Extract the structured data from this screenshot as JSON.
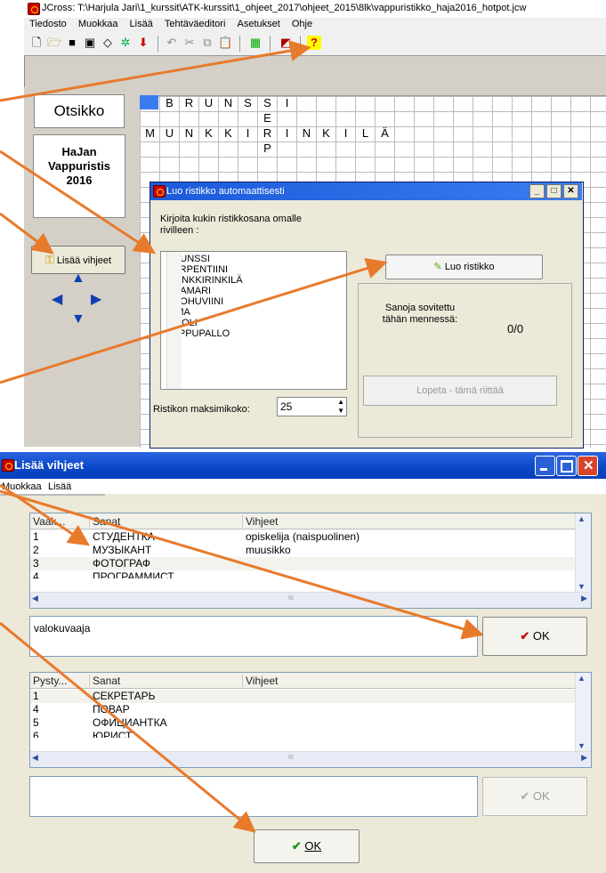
{
  "jcross": {
    "title": "JCross: T:\\Harjula Jari\\1_kurssit\\ATK-kurssit\\1_ohjeet_2017\\ohjeet_2015\\8lk\\vappuristikko_haja2016_hotpot.jcw",
    "menu": [
      "Tiedosto",
      "Muokkaa",
      "Lisää",
      "Tehtäväeditori",
      "Asetukset",
      "Ohje"
    ],
    "otsikko_label": "Otsikko",
    "title_lines": [
      "HaJan",
      "Vappuristis",
      "2016"
    ],
    "lisaa_vihjeet_button": "Lisää vihjeet",
    "grid_rows": [
      {
        "row": 0,
        "start": 1,
        "letters": [
          "B",
          "R",
          "U",
          "N",
          "S",
          "S",
          "I"
        ]
      },
      {
        "row": 1,
        "start": 6,
        "letters": [
          "E"
        ]
      },
      {
        "row": 2,
        "start": 0,
        "letters": [
          "M",
          "U",
          "N",
          "K",
          "K",
          "I",
          "R",
          "I",
          "N",
          "K",
          "I",
          "L",
          "Ä"
        ]
      },
      {
        "row": 3,
        "start": 6,
        "letters": [
          "P"
        ]
      }
    ]
  },
  "luo": {
    "title": "Luo ristikko automaattisesti",
    "instruction_line1": "Kirjoita kukin ristikkosana omalle",
    "instruction_line2": "rivilleen :",
    "words": [
      "BRUNSSI",
      "SERPENTIINI",
      "MUNKKIRINKILÄ",
      "NAAMARI",
      "KUOHUVIINI",
      "SIMA",
      "TIVOLI",
      "VAPPUPALLO"
    ],
    "luo_button": "Luo ristikko",
    "fitted_label_line1": "Sanoja sovitettu",
    "fitted_label_line2": "tähän mennessä:",
    "fitted_value": "0/0",
    "lopeta_button": "Lopeta - tämä riittää",
    "max_label": "Ristikon maksimikoko:",
    "max_value": "25"
  },
  "lisaa": {
    "title": "Lisää vihjeet",
    "menu": [
      "Muokkaa",
      "Lisää"
    ],
    "across": {
      "headers": [
        "Vaak...",
        "Sanat",
        "Vihjeet"
      ],
      "rows": [
        {
          "n": "1",
          "word": "СТУДЕНТКА",
          "clue": "opiskelija (naispuolinen)"
        },
        {
          "n": "2",
          "word": "МУЗЫКАНТ",
          "clue": "muusikko"
        },
        {
          "n": "3",
          "word": "ФОТОГРАФ",
          "clue": ""
        },
        {
          "n": "4",
          "word": "ПРОГРАММИСТ",
          "clue": ""
        }
      ]
    },
    "across_memo": "valokuvaaja",
    "ok_label": "OK",
    "down": {
      "headers": [
        "Pysty...",
        "Sanat",
        "Vihjeet"
      ],
      "rows": [
        {
          "n": "1",
          "word": "СЕКРЕТАРЬ",
          "clue": ""
        },
        {
          "n": "4",
          "word": "ПОВАР",
          "clue": ""
        },
        {
          "n": "5",
          "word": "ОФИЦИАНТКА",
          "clue": ""
        },
        {
          "n": "6",
          "word": "ЮРИСТ",
          "clue": ""
        }
      ]
    },
    "down_memo": "",
    "final_ok_label": "OK",
    "scroll_grip": "III"
  },
  "colors": {
    "arrow": "#e87a2c",
    "titlebar": "#0a46c6",
    "check": "#c01010"
  }
}
